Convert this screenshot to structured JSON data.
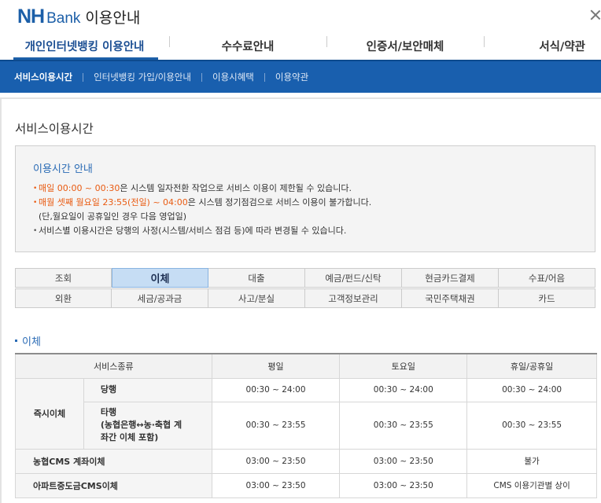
{
  "header": {
    "logo_nh": "NH",
    "logo_bank": "Bank",
    "title": "이용안내"
  },
  "top_tabs": [
    "개인인터넷뱅킹 이용안내",
    "수수료안내",
    "인증서/보안매체",
    "서식/약관"
  ],
  "sub_nav": [
    "서비스이용시간",
    "인터넷뱅킹 가입/이용안내",
    "이용시혜택",
    "이용약관"
  ],
  "page_title": "서비스이용시간",
  "notice": {
    "title": "이용시간 안내",
    "line1_highlight": "매일 00:00 ~ 00:30",
    "line1_rest": "은 시스템 일자전환 작업으로 서비스 이용이 제한될 수 있습니다.",
    "line2_highlight": "매월 셋째 월요일 23:55(전일) ~ 04:00",
    "line2_rest": "은 시스템 정기점검으로 서비스 이용이 불가합니다.",
    "line2_note": "(단,월요일이 공휴일인 경우 다음 영업일)",
    "line3": "서비스별 이용시간은 당행의 사정(시스템/서비스 점검 등)에 따라 변경될 수 있습니다."
  },
  "categories_row1": [
    "조회",
    "이체",
    "대출",
    "예금/펀드/신탁",
    "현금카드결제",
    "수표/어음"
  ],
  "categories_row2": [
    "외환",
    "세금/공과금",
    "사고/분실",
    "고객정보관리",
    "국민주택채권",
    "카드"
  ],
  "section_title": "이체",
  "table": {
    "headers": [
      "서비스종류",
      "평일",
      "토요일",
      "휴일/공휴일"
    ],
    "group_label": "즉시이체",
    "rows": [
      {
        "name": "당행",
        "weekday": "00:30 ~ 24:00",
        "saturday": "00:30 ~ 24:00",
        "holiday": "00:30 ~ 24:00"
      },
      {
        "name_line1": "타행",
        "name_line2": "(농협은행↔농·축협 계",
        "name_line3": "좌간 이체 포함)",
        "weekday": "00:30 ~ 23:55",
        "saturday": "00:30 ~ 23:55",
        "holiday": "00:30 ~ 23:55"
      },
      {
        "name": "농협CMS 계좌이체",
        "weekday": "03:00 ~ 23:50",
        "saturday": "03:00 ~ 23:50",
        "holiday": "불가"
      },
      {
        "name": "아파트중도금CMS이체",
        "weekday": "03:00 ~ 23:50",
        "saturday": "03:00 ~ 23:50",
        "holiday": "CMS 이용기관별 상이"
      }
    ]
  },
  "colors": {
    "brand_blue": "#1c5fa8",
    "subnav_blue": "#195fae",
    "highlight_orange": "#e95b12",
    "active_tab_bg": "#c6ddf4"
  },
  "icons": {
    "close": "close-icon"
  }
}
